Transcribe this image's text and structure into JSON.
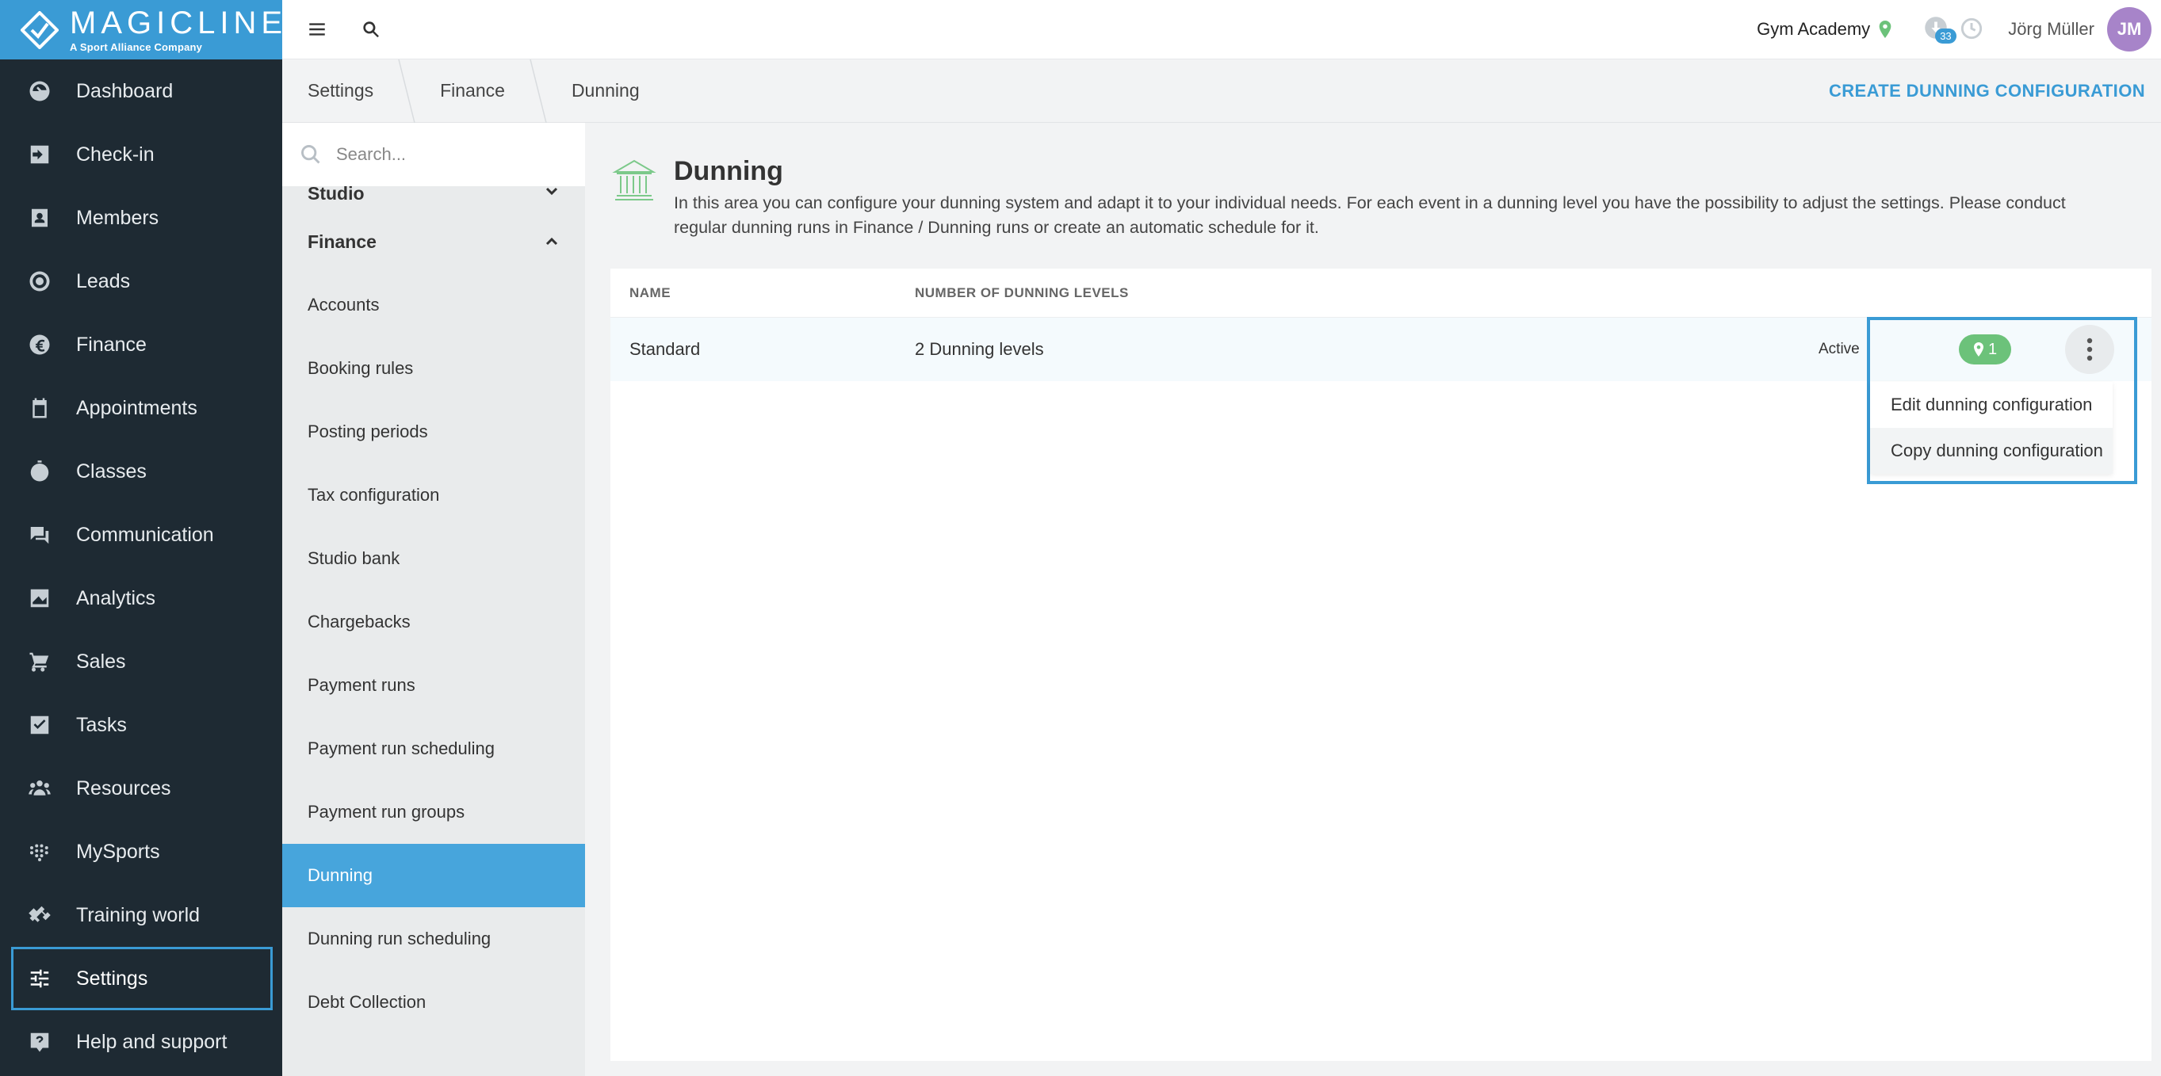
{
  "brand": {
    "name": "MAGICLINE",
    "tagline": "A Sport Alliance Company"
  },
  "nav": {
    "items": [
      {
        "label": "Dashboard",
        "icon": "dashboard-icon"
      },
      {
        "label": "Check-in",
        "icon": "check-in-icon"
      },
      {
        "label": "Members",
        "icon": "members-icon"
      },
      {
        "label": "Leads",
        "icon": "leads-icon"
      },
      {
        "label": "Finance",
        "icon": "euro-icon"
      },
      {
        "label": "Appointments",
        "icon": "calendar-icon"
      },
      {
        "label": "Classes",
        "icon": "stopwatch-icon"
      },
      {
        "label": "Communication",
        "icon": "chat-icon"
      },
      {
        "label": "Analytics",
        "icon": "chart-icon"
      },
      {
        "label": "Sales",
        "icon": "cart-icon"
      },
      {
        "label": "Tasks",
        "icon": "checkbox-icon"
      },
      {
        "label": "Resources",
        "icon": "people-icon"
      },
      {
        "label": "MySports",
        "icon": "dots-grid-icon"
      },
      {
        "label": "Training world",
        "icon": "dumbbell-icon"
      },
      {
        "label": "Settings",
        "icon": "sliders-icon"
      },
      {
        "label": "Help and support",
        "icon": "help-icon"
      }
    ],
    "selected": "Settings"
  },
  "topbar": {
    "studio": "Gym Academy",
    "notification_count": "33",
    "user_name": "Jörg Müller",
    "avatar_initials": "JM"
  },
  "breadcrumb": [
    "Settings",
    "Finance",
    "Dunning"
  ],
  "create_button": "CREATE DUNNING CONFIGURATION",
  "submenu": {
    "search_placeholder": "Search...",
    "groups": {
      "studio": "Studio",
      "finance": "Finance"
    },
    "items": [
      "Accounts",
      "Booking rules",
      "Posting periods",
      "Tax configuration",
      "Studio bank",
      "Chargebacks",
      "Payment runs",
      "Payment run scheduling",
      "Payment run groups",
      "Dunning",
      "Dunning run scheduling",
      "Debt Collection"
    ],
    "active": "Dunning"
  },
  "page": {
    "title": "Dunning",
    "description": "In this area you can configure your dunning system and adapt it to your individual needs. For each event in a dunning level you have the possibility to adjust the settings. Please conduct regular dunning runs in Finance / Dunning runs or create an automatic schedule for it."
  },
  "table": {
    "headers": {
      "name": "NAME",
      "levels": "NUMBER OF DUNNING LEVELS"
    },
    "rows": [
      {
        "name": "Standard",
        "levels": "2 Dunning levels",
        "status": "Active",
        "locations": "1"
      }
    ]
  },
  "row_menu": {
    "items": [
      "Edit dunning configuration",
      "Copy dunning configuration"
    ]
  },
  "colors": {
    "accent": "#3a9bd5",
    "sidebar": "#1e2a33",
    "success": "#6cc27a",
    "avatar": "#a784c9"
  }
}
